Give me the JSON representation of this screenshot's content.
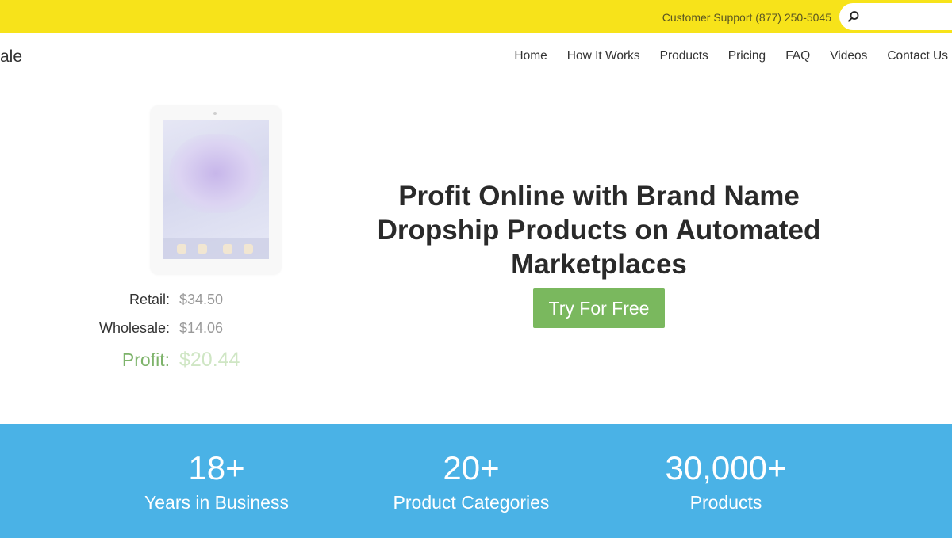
{
  "topbar": {
    "support_text": "Customer Support (877) 250-5045",
    "search_placeholder": ""
  },
  "header": {
    "logo_text": "ale",
    "nav": [
      "Home",
      "How It Works",
      "Products",
      "Pricing",
      "FAQ",
      "Videos",
      "Contact Us"
    ]
  },
  "hero": {
    "headline": "Profit Online with Brand Name Dropship Products on Automated Marketplaces",
    "cta_label": "Try For Free",
    "pricing": {
      "retail_label": "Retail:",
      "retail_value": "$34.50",
      "wholesale_label": "Wholesale:",
      "wholesale_value": "$14.06",
      "profit_label": "Profit:",
      "profit_value": "$20.44"
    }
  },
  "stats": [
    {
      "value": "18+",
      "label": "Years in Business"
    },
    {
      "value": "20+",
      "label": "Product Categories"
    },
    {
      "value": "30,000+",
      "label": "Products"
    }
  ],
  "colors": {
    "topbar": "#f7e31a",
    "cta": "#7ab85e",
    "profit": "#7db36a",
    "stats_band": "#4ab2e6"
  }
}
